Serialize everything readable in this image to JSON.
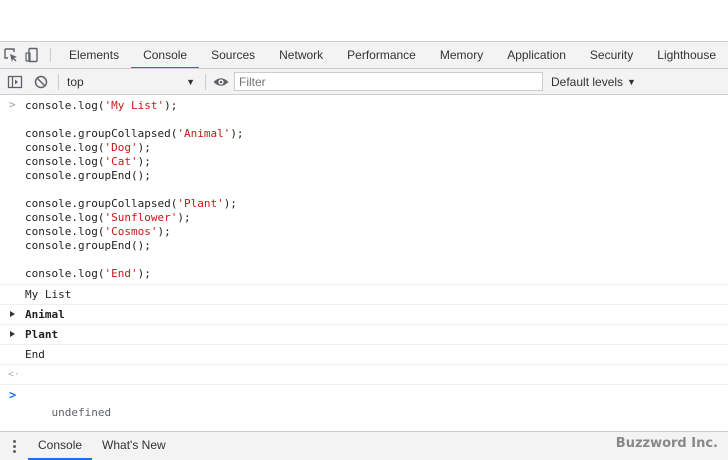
{
  "tabs": [
    {
      "label": "Elements"
    },
    {
      "label": "Console"
    },
    {
      "label": "Sources"
    },
    {
      "label": "Network"
    },
    {
      "label": "Performance"
    },
    {
      "label": "Memory"
    },
    {
      "label": "Application"
    },
    {
      "label": "Security"
    },
    {
      "label": "Lighthouse"
    }
  ],
  "active_tab": "Console",
  "toolbar": {
    "context": "top",
    "filter_placeholder": "Filter",
    "levels_label": "Default levels"
  },
  "console": {
    "input_lines": [
      [
        {
          "t": "console.log("
        },
        {
          "t": "'My List'",
          "s": true
        },
        {
          "t": ");"
        }
      ],
      [],
      [
        {
          "t": "console.groupCollapsed("
        },
        {
          "t": "'Animal'",
          "s": true
        },
        {
          "t": ");"
        }
      ],
      [
        {
          "t": "console.log("
        },
        {
          "t": "'Dog'",
          "s": true
        },
        {
          "t": ");"
        }
      ],
      [
        {
          "t": "console.log("
        },
        {
          "t": "'Cat'",
          "s": true
        },
        {
          "t": ");"
        }
      ],
      [
        {
          "t": "console.groupEnd();"
        }
      ],
      [],
      [
        {
          "t": "console.groupCollapsed("
        },
        {
          "t": "'Plant'",
          "s": true
        },
        {
          "t": ");"
        }
      ],
      [
        {
          "t": "console.log("
        },
        {
          "t": "'Sunflower'",
          "s": true
        },
        {
          "t": ");"
        }
      ],
      [
        {
          "t": "console.log("
        },
        {
          "t": "'Cosmos'",
          "s": true
        },
        {
          "t": ");"
        }
      ],
      [
        {
          "t": "console.groupEnd();"
        }
      ],
      [],
      [
        {
          "t": "console.log("
        },
        {
          "t": "'End'",
          "s": true
        },
        {
          "t": ");"
        }
      ]
    ],
    "messages": [
      {
        "text": "My List",
        "group": false
      },
      {
        "text": "Animal",
        "group": true
      },
      {
        "text": "Plant",
        "group": true
      },
      {
        "text": "End",
        "group": false
      }
    ],
    "result": "undefined"
  },
  "drawer": {
    "tabs": [
      {
        "label": "Console"
      },
      {
        "label": "What's New"
      }
    ],
    "active": "Console"
  },
  "watermark": "Buzzword Inc.",
  "colors": {
    "accent": "#1a73e8",
    "string": "#c41a16"
  }
}
